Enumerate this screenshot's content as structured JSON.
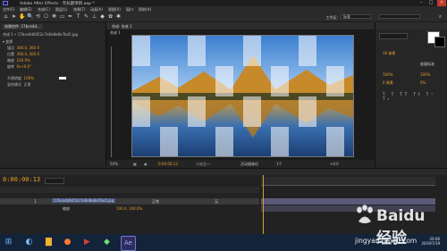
{
  "window": {
    "title": "Adobe After Effects - 无标题项目.aep *"
  },
  "menu": [
    "文件(F)",
    "编辑(E)",
    "合成(C)",
    "图层(L)",
    "效果(T)",
    "动画(A)",
    "视图(V)",
    "窗口",
    "帮助(H)"
  ],
  "toolbar": {
    "workspace_label": "工作区:",
    "workspace_value": "标准"
  },
  "effects_panel": {
    "tab": "效果控件: 17bce4d...",
    "layer_name": "合成 1 • 17bce4d6452c7e6e8e8e7be5.jpg",
    "section": "变换",
    "rows": [
      {
        "label": "锚点",
        "value": "360.0, 360.0"
      },
      {
        "label": "位置",
        "value": "360.0, 360.0"
      },
      {
        "label": "缩放",
        "value": "100.0%"
      },
      {
        "label": "旋转",
        "value": "0x+0.0°"
      },
      {
        "label": "不透明度",
        "value": "100%"
      },
      {
        "label": "混合模式",
        "value": "正常"
      }
    ]
  },
  "composition": {
    "tab": "合成: 合成 1",
    "tab2": "合成 1",
    "zoom": "50%",
    "time": "0:00:00:13",
    "resolution": "二分之一",
    "view": "活动摄像机",
    "views_count": "1个",
    "exposure": "+0.0"
  },
  "right_panel": {
    "font_size": "18 像素",
    "tracking_label": "度量标准",
    "scale_v": "100%",
    "scale_h": "100%",
    "baseline": "0 像素",
    "tsume": "0%"
  },
  "timeline": {
    "timecode": "0:00:00:13",
    "layer_index": "1",
    "layer_name": "17bce4d6452c7e6e8e8e7be5.jpg",
    "mode": "正常",
    "parent": "无",
    "sub_row": "缩放",
    "sub_value": "100.0, 100.0%"
  },
  "taskbar": {
    "time": "20:06",
    "date": "2019/7/19"
  },
  "watermark": {
    "brand": "Baidu 经验",
    "url": "jingyan.baidu.com"
  },
  "colors": {
    "accent": "#e89b2a",
    "bg": "#232323",
    "track": "#5b5a7a",
    "taskbar": "#13233a"
  }
}
